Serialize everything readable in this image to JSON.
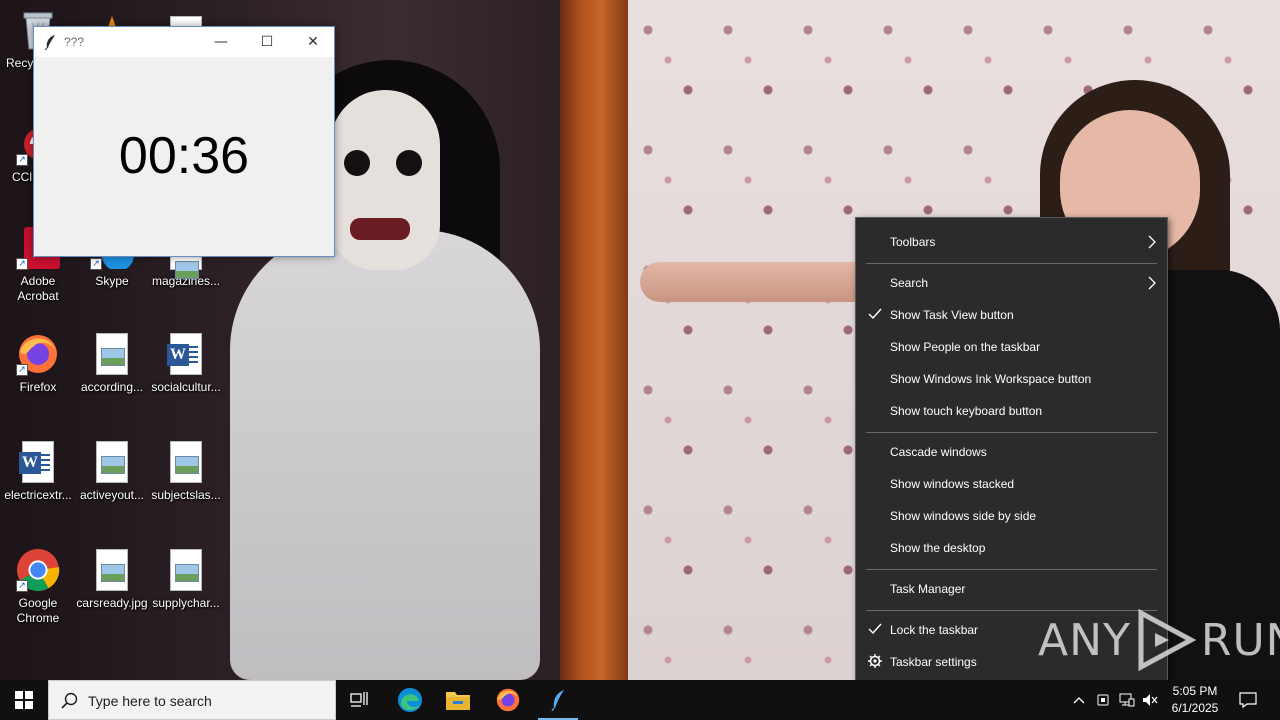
{
  "desktop": {
    "icons": [
      {
        "label": "Recy",
        "kind": "recycle-bin"
      },
      {
        "label": "",
        "kind": "vlc"
      },
      {
        "label": "",
        "kind": "file"
      },
      {
        "label": "CCl",
        "kind": "ccleaner"
      },
      {
        "label": "Adobe Acrobat",
        "kind": "acrobat"
      },
      {
        "label": "Skype",
        "kind": "skype"
      },
      {
        "label": "magazines...",
        "kind": "image-file"
      },
      {
        "label": "Firefox",
        "kind": "firefox"
      },
      {
        "label": "according...",
        "kind": "image-file"
      },
      {
        "label": "socialcultur...",
        "kind": "word-file"
      },
      {
        "label": "electricextr...",
        "kind": "word-file"
      },
      {
        "label": "activeyout...",
        "kind": "image-file"
      },
      {
        "label": "subjectslas...",
        "kind": "image-file"
      },
      {
        "label": "Google Chrome",
        "kind": "chrome"
      },
      {
        "label": "carsready.jpg",
        "kind": "image-file"
      },
      {
        "label": "supplychar...",
        "kind": "image-file"
      }
    ]
  },
  "timer_window": {
    "title": "???",
    "timer_value": "00:36",
    "minimize_glyph": "—",
    "maximize_glyph": "☐",
    "close_glyph": "✕"
  },
  "context_menu": {
    "toolbars": "Toolbars",
    "search": "Search",
    "show_task_view": "Show Task View button",
    "show_people": "Show People on the taskbar",
    "show_ink": "Show Windows Ink Workspace button",
    "show_touch_keyboard": "Show touch keyboard button",
    "cascade": "Cascade windows",
    "stacked": "Show windows stacked",
    "side_by_side": "Show windows side by side",
    "show_desktop": "Show the desktop",
    "task_manager": "Task Manager",
    "lock_taskbar": "Lock the taskbar",
    "taskbar_settings": "Taskbar settings"
  },
  "watermark": {
    "left": "ANY",
    "right": "RUN"
  },
  "taskbar": {
    "search_placeholder": "Type here to search",
    "time": "5:05 PM",
    "date": "6/1/2025"
  },
  "colors": {
    "menu_bg": "#2b2b2b",
    "taskbar_bg": "#101010",
    "accent": "#76b9ed"
  }
}
